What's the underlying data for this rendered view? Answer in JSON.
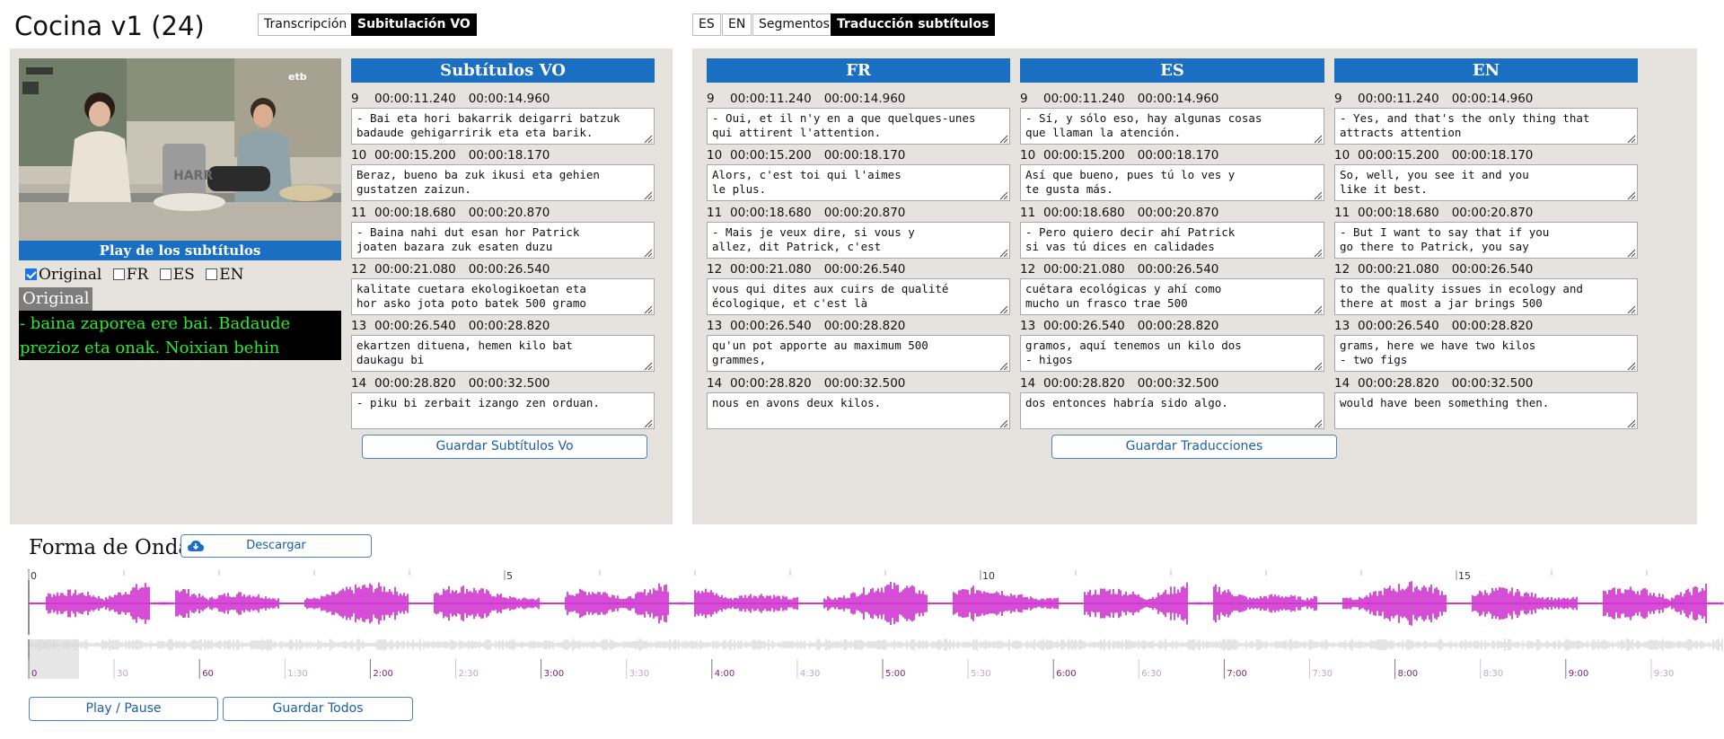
{
  "app": {
    "title": "Cocina v1 (24)"
  },
  "tabs_left": [
    {
      "label": "Transcripción",
      "active": false
    },
    {
      "label": "Subitulación VO",
      "active": true
    }
  ],
  "tabs_right": [
    {
      "label": "ES",
      "active": false
    },
    {
      "label": "EN",
      "active": false
    },
    {
      "label": "Segmentos",
      "active": false
    },
    {
      "label": "Traducción subtítulos",
      "active": true
    }
  ],
  "player": {
    "play_label": "Play de los subtítulos",
    "channel_logo": "etb",
    "checkboxes": [
      {
        "label": "Original",
        "checked": true
      },
      {
        "label": "FR",
        "checked": false
      },
      {
        "label": "ES",
        "checked": false
      },
      {
        "label": "EN",
        "checked": false
      }
    ],
    "current_label": "Original",
    "current_text": "- baina zaporea ere bai. Badaude\nprezioz eta onak. Noixian behin"
  },
  "vo": {
    "header": "Subtítulos VO",
    "save_label": "Guardar Subtítulos Vo",
    "segments": [
      {
        "n": "9",
        "start": "00:00:11.240",
        "end": "00:00:14.960",
        "text": "- Bai eta hori bakarrik deigarri batzuk\nbadaude gehigarririk eta eta barik."
      },
      {
        "n": "10",
        "start": "00:00:15.200",
        "end": "00:00:18.170",
        "text": "Beraz, bueno ba zuk ikusi eta gehien\ngustatzen zaizun."
      },
      {
        "n": "11",
        "start": "00:00:18.680",
        "end": "00:00:20.870",
        "text": "- Baina nahi dut esan hor Patrick\njoaten bazara zuk esaten duzu"
      },
      {
        "n": "12",
        "start": "00:00:21.080",
        "end": "00:00:26.540",
        "text": "kalitate cuetara ekologikoetan eta\nhor asko jota poto batek 500 gramo"
      },
      {
        "n": "13",
        "start": "00:00:26.540",
        "end": "00:00:28.820",
        "text": "ekartzen dituena, hemen kilo bat\ndaukagu bi"
      },
      {
        "n": "14",
        "start": "00:00:28.820",
        "end": "00:00:32.500",
        "text": "- piku bi zerbait izango zen orduan."
      }
    ]
  },
  "translations": {
    "save_label": "Guardar Traducciones",
    "columns": [
      {
        "header": "FR",
        "segments": [
          {
            "n": "9",
            "start": "00:00:11.240",
            "end": "00:00:14.960",
            "text": "- Oui, et il n'y en a que quelques-unes\nqui attirent l'attention."
          },
          {
            "n": "10",
            "start": "00:00:15.200",
            "end": "00:00:18.170",
            "text": "Alors, c'est toi qui l'aimes\nle plus."
          },
          {
            "n": "11",
            "start": "00:00:18.680",
            "end": "00:00:20.870",
            "text": "- Mais je veux dire, si vous y\nallez, dit Patrick, c'est"
          },
          {
            "n": "12",
            "start": "00:00:21.080",
            "end": "00:00:26.540",
            "text": "vous qui dites aux cuirs de qualité\nécologique, et c'est là"
          },
          {
            "n": "13",
            "start": "00:00:26.540",
            "end": "00:00:28.820",
            "text": "qu'un pot apporte au maximum 500\ngrammes,"
          },
          {
            "n": "14",
            "start": "00:00:28.820",
            "end": "00:00:32.500",
            "text": "nous en avons deux kilos."
          }
        ]
      },
      {
        "header": "ES",
        "segments": [
          {
            "n": "9",
            "start": "00:00:11.240",
            "end": "00:00:14.960",
            "text": "- Sí, y sólo eso, hay algunas cosas\nque llaman la atención."
          },
          {
            "n": "10",
            "start": "00:00:15.200",
            "end": "00:00:18.170",
            "text": "Así que bueno, pues tú lo ves y\nte gusta más."
          },
          {
            "n": "11",
            "start": "00:00:18.680",
            "end": "00:00:20.870",
            "text": "- Pero quiero decir ahí Patrick\nsi vas tú dices en calidades"
          },
          {
            "n": "12",
            "start": "00:00:21.080",
            "end": "00:00:26.540",
            "text": "cuétara ecológicas y ahí como\nmucho un frasco trae 500"
          },
          {
            "n": "13",
            "start": "00:00:26.540",
            "end": "00:00:28.820",
            "text": "gramos, aquí tenemos un kilo dos\n- higos"
          },
          {
            "n": "14",
            "start": "00:00:28.820",
            "end": "00:00:32.500",
            "text": "dos entonces habría sido algo."
          }
        ]
      },
      {
        "header": "EN",
        "segments": [
          {
            "n": "9",
            "start": "00:00:11.240",
            "end": "00:00:14.960",
            "text": "- Yes, and that's the only thing that\nattracts attention"
          },
          {
            "n": "10",
            "start": "00:00:15.200",
            "end": "00:00:18.170",
            "text": "So, well, you see it and you\nlike it best."
          },
          {
            "n": "11",
            "start": "00:00:18.680",
            "end": "00:00:20.870",
            "text": "- But I want to say that if you\ngo there to Patrick, you say"
          },
          {
            "n": "12",
            "start": "00:00:21.080",
            "end": "00:00:26.540",
            "text": "to the quality issues in ecology and\nthere at most a jar brings 500"
          },
          {
            "n": "13",
            "start": "00:00:26.540",
            "end": "00:00:28.820",
            "text": "grams, here we have two kilos\n- two figs"
          },
          {
            "n": "14",
            "start": "00:00:28.820",
            "end": "00:00:32.500",
            "text": "would have been something then."
          }
        ]
      }
    ]
  },
  "waveform": {
    "title": "Forma de Onda",
    "download_label": "Descargar",
    "wave_color": "#cc22cc",
    "overview_color": "#d9d9d9",
    "top_ticks": [
      "0",
      "5",
      "10",
      "15"
    ],
    "bottom_ticks": [
      {
        "label": "0",
        "major": true
      },
      {
        "label": "30",
        "major": false
      },
      {
        "label": "60",
        "major": true
      },
      {
        "label": "1:30",
        "major": false
      },
      {
        "label": "2:00",
        "major": true
      },
      {
        "label": "2:30",
        "major": false
      },
      {
        "label": "3:00",
        "major": true
      },
      {
        "label": "3:30",
        "major": false
      },
      {
        "label": "4:00",
        "major": true
      },
      {
        "label": "4:30",
        "major": false
      },
      {
        "label": "5:00",
        "major": true
      },
      {
        "label": "5:30",
        "major": false
      },
      {
        "label": "6:00",
        "major": true
      },
      {
        "label": "6:30",
        "major": false
      },
      {
        "label": "7:00",
        "major": true
      },
      {
        "label": "7:30",
        "major": false
      },
      {
        "label": "8:00",
        "major": true
      },
      {
        "label": "8:30",
        "major": false
      },
      {
        "label": "9:00",
        "major": true
      },
      {
        "label": "9:30",
        "major": false
      }
    ],
    "play_label": "Play / Pause",
    "save_all_label": "Guardar Todos"
  }
}
